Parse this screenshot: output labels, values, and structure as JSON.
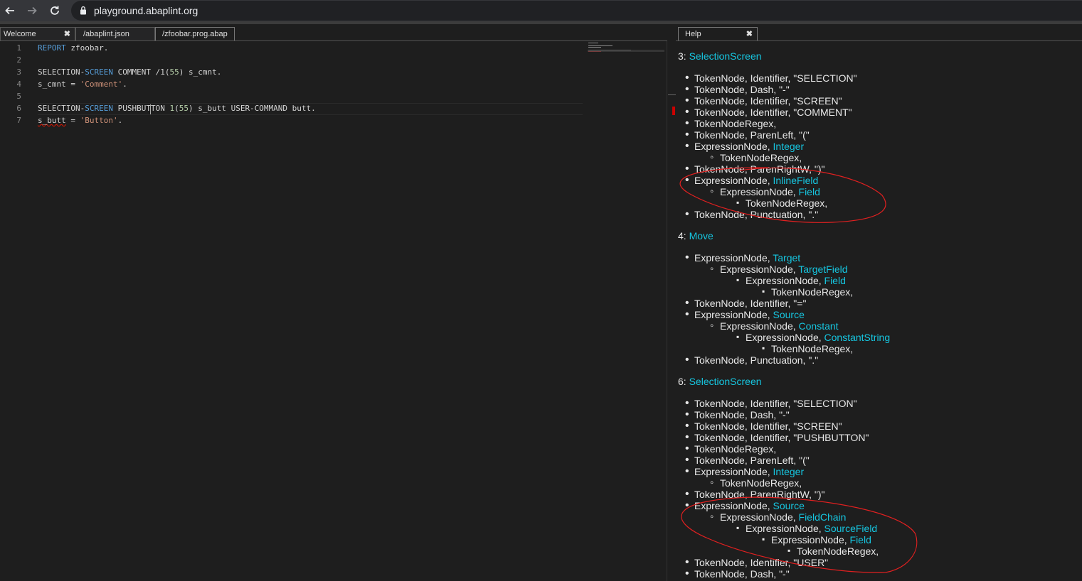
{
  "browser": {
    "url": "playground.abaplint.org"
  },
  "tabs": [
    {
      "label": "Welcome",
      "close": "✖"
    },
    {
      "label": "/abaplint.json"
    },
    {
      "label": "/zfoobar.prog.abap"
    }
  ],
  "help_tab": {
    "label": "Help",
    "close": "✖"
  },
  "editor": {
    "line_numbers": [
      "1",
      "2",
      "3",
      "4",
      "5",
      "6",
      "7"
    ],
    "l1": {
      "kw": "REPORT",
      "rest": " zfoobar."
    },
    "l3": {
      "a": "SELECTION-",
      "kw": "SCREEN",
      "b": " COMMENT /1(",
      "num": "55",
      "c": ") s_cmnt."
    },
    "l4": {
      "a": "s_cmnt = ",
      "str": "'Comment'",
      "b": "."
    },
    "l6": {
      "a": "SELECTION-",
      "kw": "SCREEN",
      "b": " PUSHBUTTON ",
      "n1": "1",
      "c": "(",
      "n2": "55",
      "d": ") s_butt USER-COMMAND butt."
    },
    "l7": {
      "var": "s_butt",
      "a": " = ",
      "str": "'Button'",
      "b": "."
    }
  },
  "help": {
    "sections": [
      {
        "prefix": "3: ",
        "title": "SelectionScreen",
        "nodes": [
          {
            "level": 1,
            "text": "TokenNode, Identifier, \"SELECTION\"",
            "link": ""
          },
          {
            "level": 1,
            "text": "TokenNode, Dash, \"-\"",
            "link": ""
          },
          {
            "level": 1,
            "text": "TokenNode, Identifier, \"SCREEN\"",
            "link": ""
          },
          {
            "level": 1,
            "text": "TokenNode, Identifier, \"COMMENT\"",
            "link": ""
          },
          {
            "level": 1,
            "text": "TokenNodeRegex,",
            "link": ""
          },
          {
            "level": 1,
            "text": "TokenNode, ParenLeft, \"(\"",
            "link": ""
          },
          {
            "level": 1,
            "text": "ExpressionNode, ",
            "link": "Integer"
          },
          {
            "level": 2,
            "text": "TokenNodeRegex,",
            "link": ""
          },
          {
            "level": 1,
            "text": "TokenNode, ParenRightW, \")\"",
            "link": ""
          },
          {
            "level": 1,
            "text": "ExpressionNode, ",
            "link": "InlineField"
          },
          {
            "level": 2,
            "text": "ExpressionNode, ",
            "link": "Field"
          },
          {
            "level": 3,
            "text": "TokenNodeRegex,",
            "link": ""
          },
          {
            "level": 1,
            "text": "TokenNode, Punctuation, \".\"",
            "link": ""
          }
        ]
      },
      {
        "prefix": "4: ",
        "title": "Move",
        "nodes": [
          {
            "level": 1,
            "text": "ExpressionNode, ",
            "link": "Target"
          },
          {
            "level": 2,
            "text": "ExpressionNode, ",
            "link": "TargetField"
          },
          {
            "level": 3,
            "text": "ExpressionNode, ",
            "link": "Field"
          },
          {
            "level": 4,
            "text": "TokenNodeRegex,",
            "link": ""
          },
          {
            "level": 1,
            "text": "TokenNode, Identifier, \"=\"",
            "link": ""
          },
          {
            "level": 1,
            "text": "ExpressionNode, ",
            "link": "Source"
          },
          {
            "level": 2,
            "text": "ExpressionNode, ",
            "link": "Constant"
          },
          {
            "level": 3,
            "text": "ExpressionNode, ",
            "link": "ConstantString"
          },
          {
            "level": 4,
            "text": "TokenNodeRegex,",
            "link": ""
          },
          {
            "level": 1,
            "text": "TokenNode, Punctuation, \".\"",
            "link": ""
          }
        ]
      },
      {
        "prefix": "6: ",
        "title": "SelectionScreen",
        "nodes": [
          {
            "level": 1,
            "text": "TokenNode, Identifier, \"SELECTION\"",
            "link": ""
          },
          {
            "level": 1,
            "text": "TokenNode, Dash, \"-\"",
            "link": ""
          },
          {
            "level": 1,
            "text": "TokenNode, Identifier, \"SCREEN\"",
            "link": ""
          },
          {
            "level": 1,
            "text": "TokenNode, Identifier, \"PUSHBUTTON\"",
            "link": ""
          },
          {
            "level": 1,
            "text": "TokenNodeRegex,",
            "link": ""
          },
          {
            "level": 1,
            "text": "TokenNode, ParenLeft, \"(\"",
            "link": ""
          },
          {
            "level": 1,
            "text": "ExpressionNode, ",
            "link": "Integer"
          },
          {
            "level": 2,
            "text": "TokenNodeRegex,",
            "link": ""
          },
          {
            "level": 1,
            "text": "TokenNode, ParenRightW, \")\"",
            "link": ""
          },
          {
            "level": 1,
            "text": "ExpressionNode, ",
            "link": "Source"
          },
          {
            "level": 2,
            "text": "ExpressionNode, ",
            "link": "FieldChain"
          },
          {
            "level": 3,
            "text": "ExpressionNode, ",
            "link": "SourceField"
          },
          {
            "level": 4,
            "text": "ExpressionNode, ",
            "link": "Field"
          },
          {
            "level": 5,
            "text": "TokenNodeRegex,",
            "link": ""
          },
          {
            "level": 1,
            "text": "TokenNode, Identifier, \"USER\"",
            "link": ""
          },
          {
            "level": 1,
            "text": "TokenNode, Dash, \"-\"",
            "link": ""
          }
        ]
      }
    ]
  },
  "colors": {
    "link": "#16c6e0",
    "keyword": "#569cd6",
    "string": "#ce9178",
    "number": "#b5cea8",
    "annotation": "#e02020"
  }
}
